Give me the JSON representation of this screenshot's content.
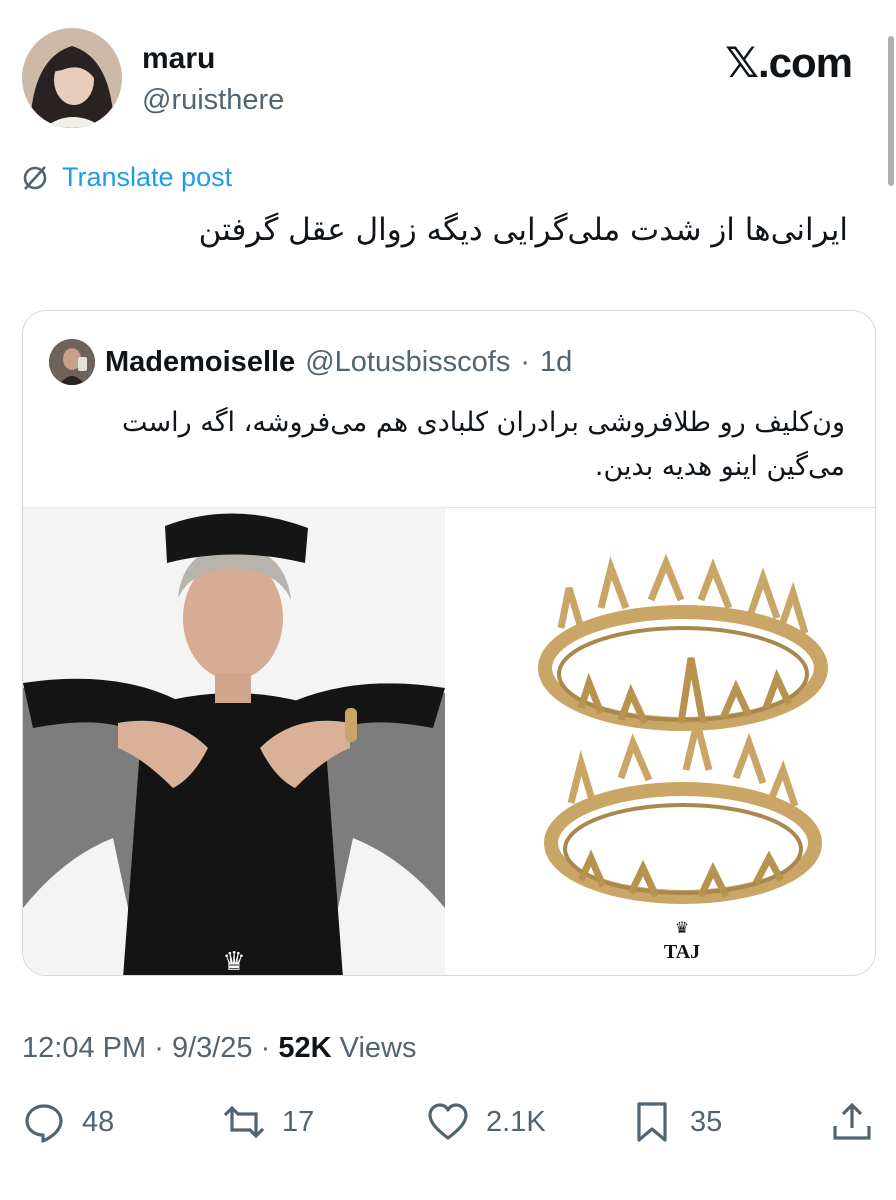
{
  "author": {
    "display_name": "maru",
    "handle": "@ruisthere"
  },
  "brand": "𝕏.com",
  "translate": {
    "label": "Translate post"
  },
  "post_text": "ایرانی‌ها از شدت ملی‌گرایی دیگه زوال عقل گرفتن",
  "quoted": {
    "display_name": "Mademoiselle",
    "handle": "@Lotusbisscofs",
    "separator": "·",
    "age": "1d",
    "text": "ون‌کلیف رو طلافروشی برادران کلبادی هم می‌فروشه، اگه راست می‌گین اینو هدیه بدین.",
    "media_left_mark": "♛",
    "media_right_logo": "TAJ",
    "media_right_crown": "♛"
  },
  "meta": {
    "time": "12:04 PM",
    "dot": "·",
    "date": "9/3/25",
    "views_count": "52K",
    "views_label": "Views"
  },
  "actions": {
    "replies": "48",
    "reposts": "17",
    "likes": "2.1K",
    "bookmarks": "35"
  },
  "colors": {
    "link": "#1d9bf0",
    "secondary": "#536471",
    "border": "#cfd9de",
    "text": "#0f1419",
    "gold": "#c9a566"
  }
}
